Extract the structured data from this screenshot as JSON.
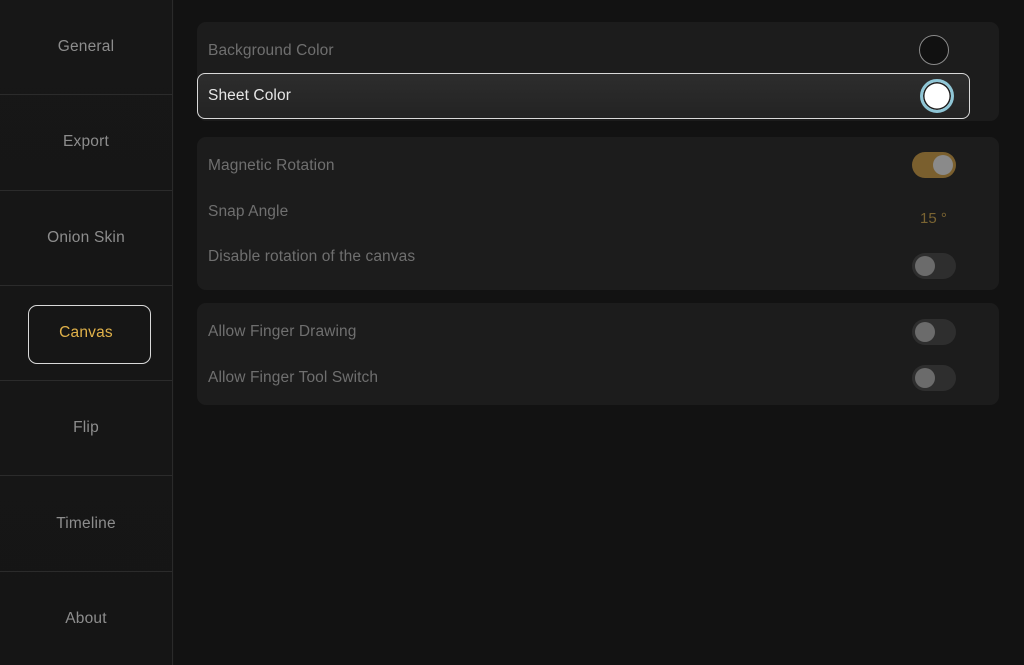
{
  "sidebar": {
    "items": [
      {
        "label": "General"
      },
      {
        "label": "Export"
      },
      {
        "label": "Onion Skin"
      },
      {
        "label": "Canvas",
        "active": true
      },
      {
        "label": "Flip"
      },
      {
        "label": "Timeline"
      },
      {
        "label": "About"
      }
    ]
  },
  "colors": {
    "accent": "#e1b24a",
    "background_swatch": "#111111",
    "sheet_swatch": "#ffffff",
    "swatch_ring": "#8fc6d6"
  },
  "groups": {
    "colors": {
      "background_color": {
        "label": "Background Color"
      },
      "sheet_color": {
        "label": "Sheet Color",
        "selected": true
      }
    },
    "rotation": {
      "magnetic_rotation": {
        "label": "Magnetic Rotation",
        "on": true
      },
      "snap_angle": {
        "label": "Snap Angle",
        "value": "15 °"
      },
      "disable_rotation": {
        "label": "Disable rotation of the canvas",
        "on": false
      }
    },
    "finger": {
      "allow_finger_drawing": {
        "label": "Allow Finger Drawing",
        "on": false
      },
      "allow_finger_tool_switch": {
        "label": "Allow Finger Tool Switch",
        "on": false
      }
    }
  }
}
